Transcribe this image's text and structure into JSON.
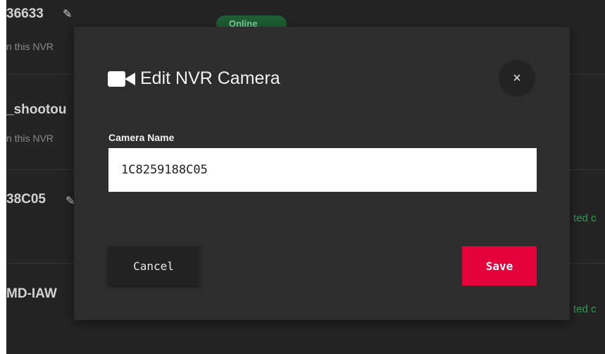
{
  "background": {
    "rows": [
      {
        "name": "36633",
        "sub": "n this NVR"
      },
      {
        "name": "_shootou",
        "sub": "n this NVR"
      },
      {
        "name": "38C05",
        "status": "ted c"
      },
      {
        "name": "MD-IAW",
        "status": "ted c"
      }
    ],
    "pill_label": "Online"
  },
  "modal": {
    "title": "Edit NVR Camera",
    "title_icon": "video-camera-icon",
    "close_label": "×",
    "field_label": "Camera Name",
    "camera_name_value": "1C8259188C05",
    "cancel_label": "Cancel",
    "save_label": "Save"
  },
  "colors": {
    "page_bg": "#242424",
    "modal_bg": "#2d2d2d",
    "save_accent": "#e4003b",
    "status_green": "#2e9e55"
  }
}
